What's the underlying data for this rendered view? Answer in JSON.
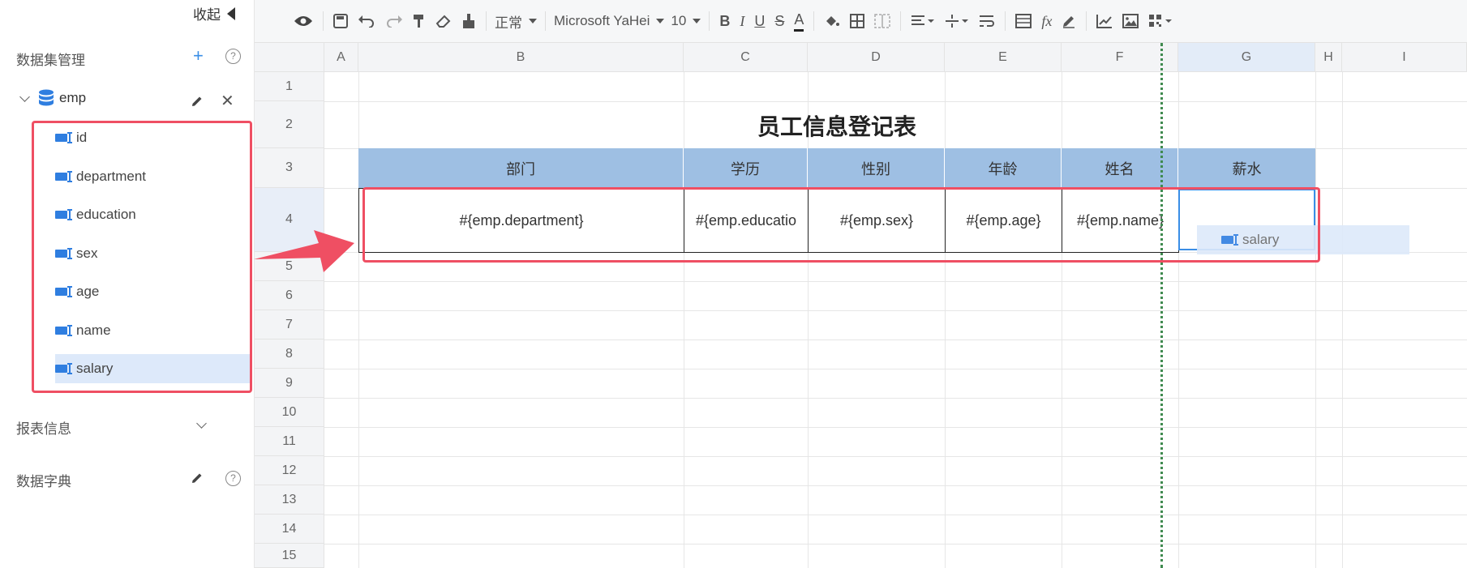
{
  "sidebar": {
    "collapse_label": "收起",
    "dataset_title": "数据集管理",
    "dataset_name": "emp",
    "fields": [
      {
        "label": "id"
      },
      {
        "label": "department"
      },
      {
        "label": "education"
      },
      {
        "label": "sex"
      },
      {
        "label": "age"
      },
      {
        "label": "name"
      },
      {
        "label": "salary"
      }
    ],
    "report_info_title": "报表信息",
    "dictionary_title": "数据字典"
  },
  "toolbar": {
    "format_label": "正常",
    "font_family": "Microsoft YaHei",
    "font_size": "10",
    "fx_label": "fx"
  },
  "sheet": {
    "columns": [
      "A",
      "B",
      "C",
      "D",
      "E",
      "F",
      "G",
      "H",
      "I"
    ],
    "rows": [
      "1",
      "2",
      "3",
      "4",
      "5",
      "6",
      "7",
      "8",
      "9",
      "10",
      "11",
      "12",
      "13",
      "14",
      "15"
    ],
    "title": "员工信息登记表",
    "headers": [
      "部门",
      "学历",
      "性别",
      "年龄",
      "姓名",
      "薪水"
    ],
    "data_row": [
      "#{emp.department}",
      "#{emp.educatio",
      "#{emp.sex}",
      "#{emp.age}",
      "#{emp.name}",
      ""
    ]
  },
  "drag": {
    "chip_label": "salary"
  },
  "colors": {
    "accent": "#3a8ee6",
    "header_fill": "#9ebfe3",
    "highlight": "#ef4f63",
    "selected_field": "#dde9fa"
  }
}
